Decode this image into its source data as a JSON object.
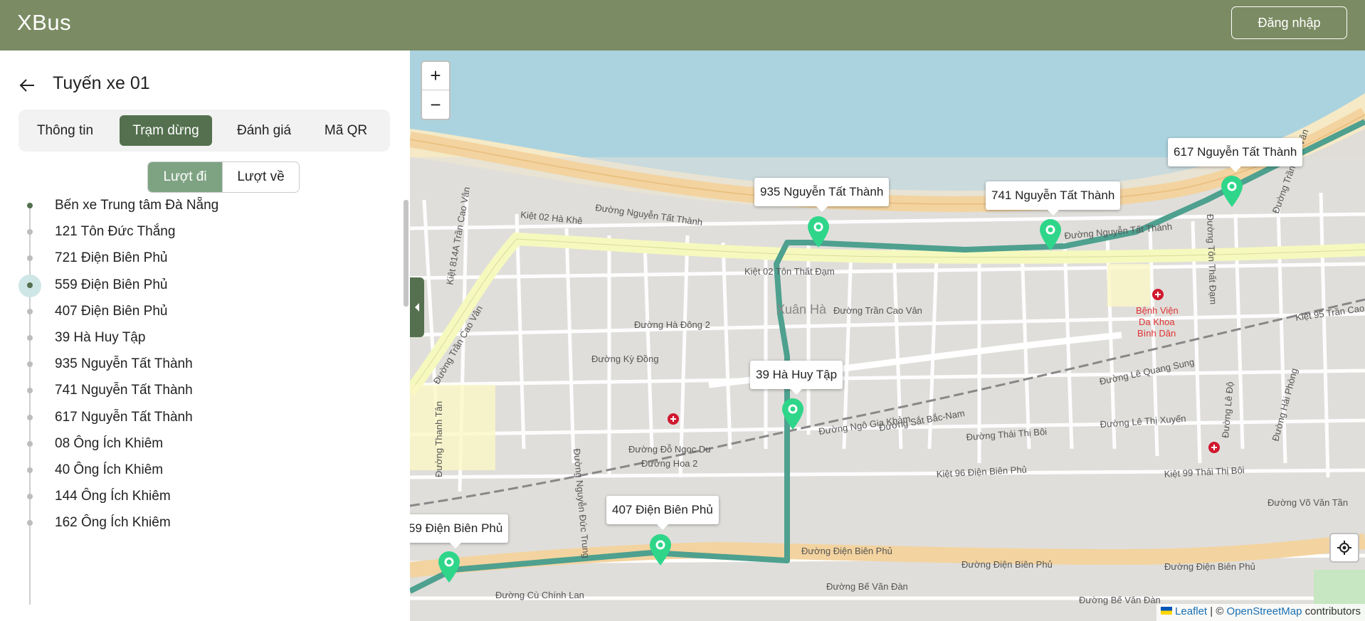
{
  "header": {
    "brand": "XBus",
    "login_label": "Đăng nhập",
    "background_color": "#7b8b63"
  },
  "sidebar": {
    "route_title": "Tuyến xe 01",
    "tabs": [
      {
        "label": "Thông tin",
        "active": false
      },
      {
        "label": "Trạm dừng",
        "active": true
      },
      {
        "label": "Đánh giá",
        "active": false
      },
      {
        "label": "Mã QR",
        "active": false
      }
    ],
    "directions": [
      {
        "label": "Lượt đi",
        "active": true
      },
      {
        "label": "Lượt về",
        "active": false
      }
    ],
    "stops": [
      "Bến xe Trung tâm Đà Nẵng",
      "121 Tôn Đức Thắng",
      "721 Điện Biên Phủ",
      "559 Điện Biên Phủ",
      "407 Điện Biên Phủ",
      "39 Hà Huy Tập",
      "935 Nguyễn Tất Thành",
      "741 Nguyễn Tất Thành",
      "617 Nguyễn Tất Thành",
      "08 Ông Ích Khiêm",
      "40 Ông Ích Khiêm",
      "144 Ông Ích Khiêm",
      "162 Ông Ích Khiêm"
    ],
    "current_stop": "559 Điện Biên Phủ",
    "active_color": "#54704f"
  },
  "map": {
    "zoom_in": "+",
    "zoom_out": "−",
    "attribution_leaflet": "Leaflet",
    "attribution_sep": " | © ",
    "attribution_osm": "OpenStreetMap",
    "attribution_tail": " contributors",
    "route_color": "#4ea08f",
    "pin_color": "#2fd68a",
    "stop_labels": [
      "935 Nguyễn Tất Thành",
      "741 Nguyễn Tất Thành",
      "617 Nguyễn Tất Thành",
      "39 Hà Huy Tập",
      "407 Điện Biên Phủ",
      "59 Điện Biên Phủ"
    ],
    "street_labels": [
      "Đường Nguyễn Tất Thành",
      "Đường Nguyễn Tất Thành",
      "Đường Trần Cao Vân",
      "Đường Trần Cao Vân",
      "Xuân Hà",
      "Đường Hà Đông 2",
      "Đường Kỳ Đồng",
      "Đường Đỗ Ngọc Du",
      "Đường Ngô Gia Khảm",
      "Đường Sắt Bắc-Nam",
      "Đường Thái Thị Bôi",
      "Đường Điện Biên Phủ",
      "Đường Điện Biên Phủ",
      "Đường Điện Biên Phủ",
      "Đường Lê Quang Sung",
      "Đường Lê Thị Xuyến",
      "Kiệt 02 Tôn Thất Đạm",
      "Kiệt 02 Hà Khê",
      "Đường Cù Chính Lan",
      "Đường Bế Văn Đàn",
      "Đường Bế Văn Đàn",
      "Đường Tôn Thất Đạm",
      "Đường Hải Phòng",
      "Đường Lê Độ",
      "Kiệt 99 Thái Thị Bôi",
      "Kiệt 96 Điện Biên Phủ",
      "Đường Thanh Tân",
      "Đường Nguyễn Đức Trung",
      "Đường Võ Văn Tần",
      "Kiệt 95 Trần Cao Vân",
      "Kiệt 814A Trần Cao Vân",
      "Đường Hoa 2",
      "Đường Trần Cao Vân"
    ],
    "poi_labels": [
      "Bệnh Viện",
      "Da Khoa",
      "Bình Dân"
    ]
  }
}
